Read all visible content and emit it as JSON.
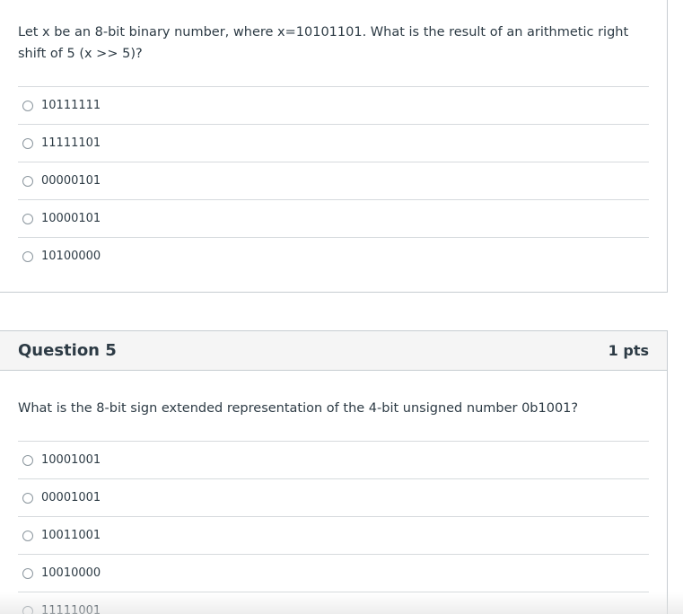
{
  "question4": {
    "text": "Let x be an 8-bit binary number, where x=10101101. What is the result of an arithmetic right shift of 5 (x >> 5)?",
    "answers": [
      "10111111",
      "11111101",
      "00000101",
      "10000101",
      "10100000"
    ]
  },
  "question5": {
    "title": "Question 5",
    "points": "1 pts",
    "text": "What is the 8-bit sign extended representation of the 4-bit unsigned number 0b1001?",
    "answers": [
      "10001001",
      "00001001",
      "10011001",
      "10010000",
      "11111001"
    ]
  }
}
